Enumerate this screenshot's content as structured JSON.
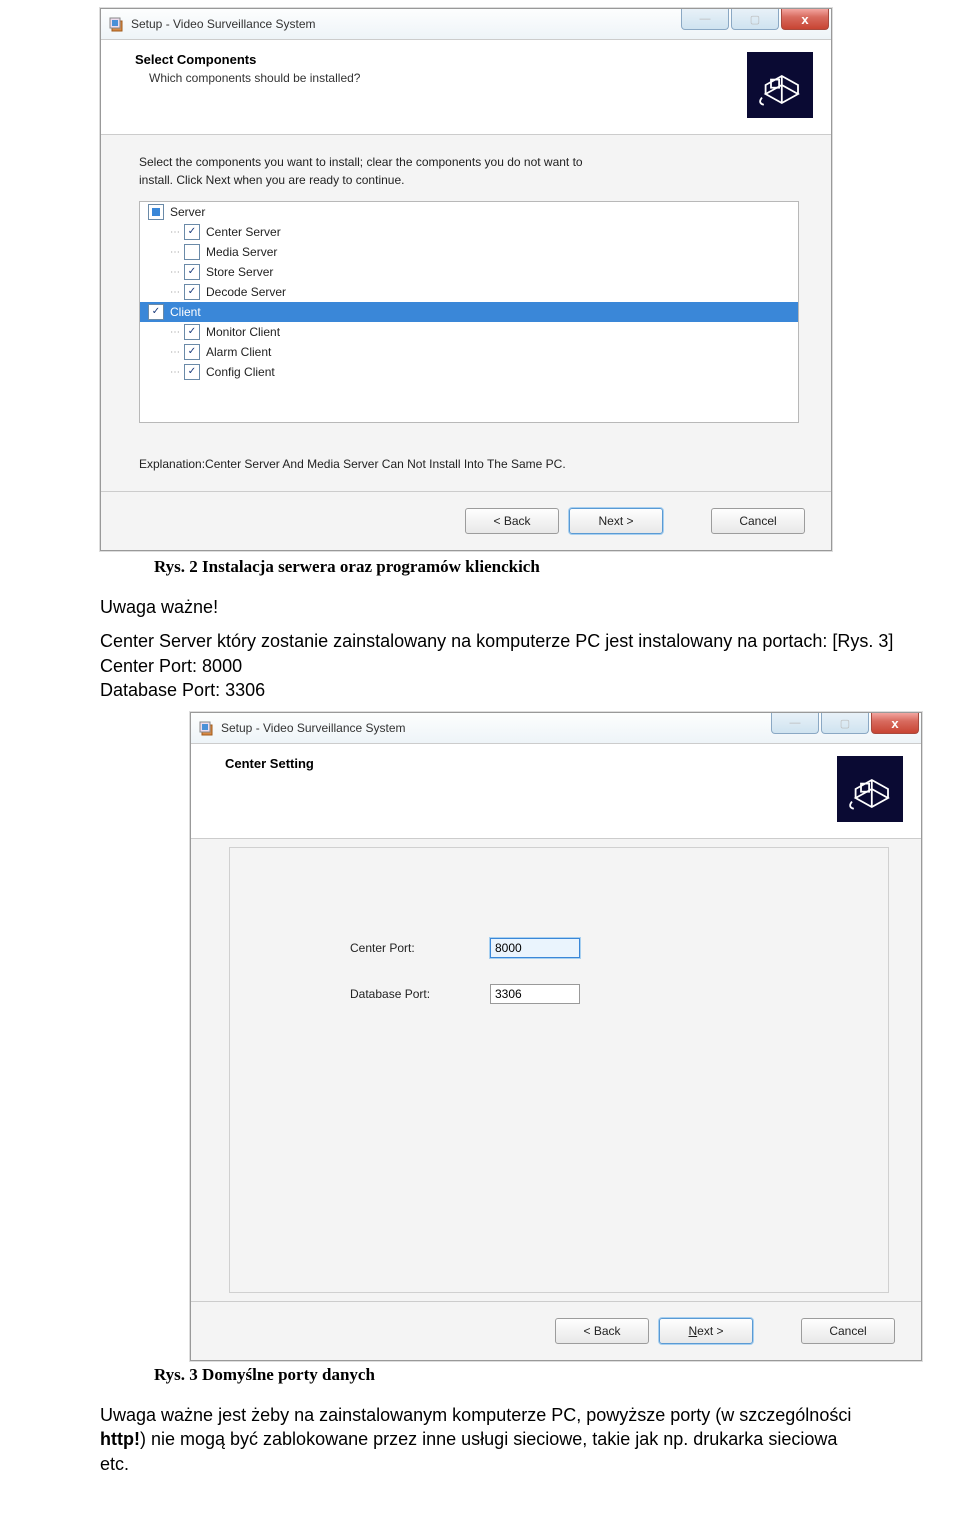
{
  "installer1": {
    "title": "Setup - Video Surveillance System",
    "win_min": "—",
    "win_max": "▢",
    "win_close": "x",
    "header_title": "Select Components",
    "header_sub": "Which components should be installed?",
    "body_line1": "Select the components you want to install; clear the components you do not want to",
    "body_line2": "install. Click Next when you are ready to continue.",
    "tree": {
      "server": "Server",
      "center": "Center Server",
      "media": "Media Server",
      "store": "Store Server",
      "decode": "Decode Server",
      "client": "Client",
      "monitor": "Monitor Client",
      "alarm": "Alarm Client",
      "config": "Config Client"
    },
    "explanation": "Explanation:Center Server And Media Server Can Not Install Into The Same PC.",
    "back": "< Back",
    "next": "Next >",
    "cancel": "Cancel"
  },
  "caption1": "Rys. 2 Instalacja serwera oraz programów klienckich",
  "para1": "Uwaga ważne!",
  "para2": "Center Server który zostanie zainstalowany na komputerze PC jest instalowany na portach: [Rys. 3]",
  "para3": "Center Port: 8000",
  "para4": "Database Port: 3306",
  "installer2": {
    "title": "Setup - Video Surveillance System",
    "header_title": "Center Setting",
    "center_port_label": "Center Port:",
    "center_port_value": "8000",
    "db_port_label": "Database Port:",
    "db_port_value": "3306",
    "back": "< Back",
    "next": "Next >",
    "cancel": "Cancel"
  },
  "caption2": "Rys. 3 Domyślne porty danych",
  "para5a": "Uwaga ważne jest żeby na zainstalowanym komputerze PC, powyższe porty (w szczególności ",
  "para5b": "http!",
  "para5c": ") nie mogą być zablokowane przez inne usługi sieciowe, takie jak np. drukarka sieciowa etc."
}
